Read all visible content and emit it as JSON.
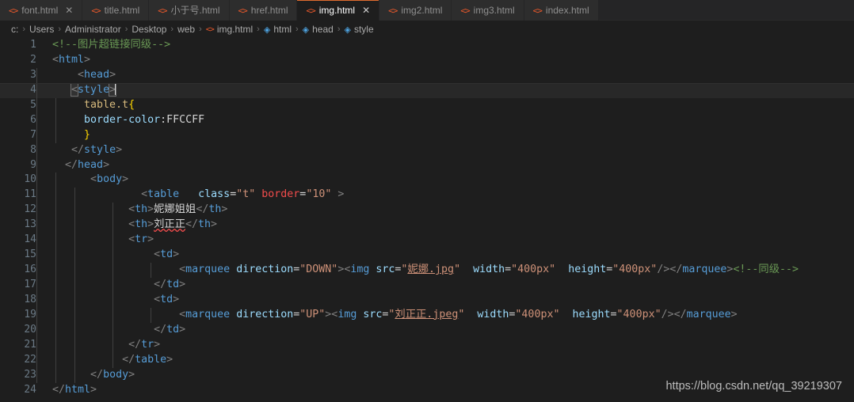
{
  "tabs": [
    {
      "label": "font.html",
      "icon": "html-file-icon",
      "active": false,
      "closable": true
    },
    {
      "label": "title.html",
      "icon": "html-file-icon",
      "active": false,
      "closable": false
    },
    {
      "label": "小于号.html",
      "icon": "html-file-icon",
      "active": false,
      "closable": false
    },
    {
      "label": "href.html",
      "icon": "html-file-icon",
      "active": false,
      "closable": false
    },
    {
      "label": "img.html",
      "icon": "html-file-icon",
      "active": true,
      "closable": true
    },
    {
      "label": "img2.html",
      "icon": "html-file-icon",
      "active": false,
      "closable": false
    },
    {
      "label": "img3.html",
      "icon": "html-file-icon",
      "active": false,
      "closable": false
    },
    {
      "label": "index.html",
      "icon": "html-file-icon",
      "active": false,
      "closable": false
    }
  ],
  "tab_close_glyph": "✕",
  "breadcrumb": [
    {
      "label": "c:",
      "icon": ""
    },
    {
      "label": "Users",
      "icon": ""
    },
    {
      "label": "Administrator",
      "icon": ""
    },
    {
      "label": "Desktop",
      "icon": ""
    },
    {
      "label": "web",
      "icon": ""
    },
    {
      "label": "img.html",
      "icon": "html-file-icon"
    },
    {
      "label": "html",
      "icon": "symbol-field-icon"
    },
    {
      "label": "head",
      "icon": "symbol-field-icon"
    },
    {
      "label": "style",
      "icon": "symbol-field-icon"
    }
  ],
  "breadcrumb_separator": "›",
  "editor": {
    "current_line": 4,
    "lines": [
      {
        "n": 1,
        "text": "    <!--图片超链接同级-->"
      },
      {
        "n": 2,
        "text": "    <html>"
      },
      {
        "n": 3,
        "text": "        <head>"
      },
      {
        "n": 4,
        "text": "        <style>"
      },
      {
        "n": 5,
        "text": "          table.t{"
      },
      {
        "n": 6,
        "text": "          border-color:FFCCFF"
      },
      {
        "n": 7,
        "text": "          }"
      },
      {
        "n": 8,
        "text": "        </style>"
      },
      {
        "n": 9,
        "text": "      </head>"
      },
      {
        "n": 10,
        "text": "          <body>"
      },
      {
        "n": 11,
        "text": "                <table   class=\"t\" border=\"10\" >"
      },
      {
        "n": 12,
        "text": "                <th>妮娜姐姐</th>"
      },
      {
        "n": 13,
        "text": "                <th>刘正正</th>"
      },
      {
        "n": 14,
        "text": "                <tr>"
      },
      {
        "n": 15,
        "text": "                    <td>"
      },
      {
        "n": 16,
        "text": "                        <marquee direction=\"DOWN\"><img src=\"妮娜.jpg\"  width=\"400px\"  height=\"400px\"/></marquee><!--同级-->"
      },
      {
        "n": 17,
        "text": "                    </td>"
      },
      {
        "n": 18,
        "text": "                    <td>"
      },
      {
        "n": 19,
        "text": "                        <marquee direction=\"UP\"><img src=\"刘正正.jpeg\"  width=\"400px\"  height=\"400px\"/></marquee>"
      },
      {
        "n": 20,
        "text": "                    </td>"
      },
      {
        "n": 21,
        "text": "                </tr>"
      },
      {
        "n": 22,
        "text": "                </table>"
      },
      {
        "n": 23,
        "text": "          </body>"
      },
      {
        "n": 24,
        "text": "    </html>"
      }
    ]
  },
  "watermark": "https://blog.csdn.net/qq_39219307",
  "colors": {
    "accent": "#e06c2f",
    "file_icon": "#e8582b",
    "symbol_icon": "#4ea3e0",
    "editor_bg": "#1e1e1e",
    "tabbar_bg": "#252526",
    "tab_inactive_bg": "#2d2d2d",
    "comment": "#6a9955",
    "tag": "#569cd6",
    "attribute": "#9cdcfe",
    "attribute_alt": "#f14c4c",
    "string": "#ce9178",
    "selector": "#d7ba7d",
    "text": "#d4d4d4",
    "line_number": "#6b7a86",
    "error_squiggle": "#f14c4c"
  }
}
